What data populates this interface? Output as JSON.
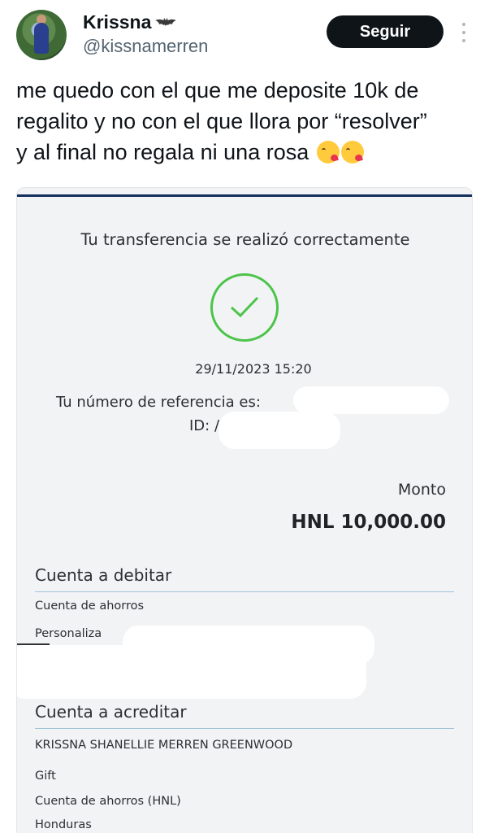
{
  "tweet": {
    "display_name": "Krissna",
    "name_icon": "bat-icon",
    "handle": "@kissnamerren",
    "follow_label": "Seguir",
    "text_lines": [
      "me quedo con el que me deposite 10k de",
      "regalito y no con el que llora por “resolver”",
      "y al final no regala ni una rosa"
    ],
    "emojis": [
      "kissing-face-icon",
      "kissing-face-icon"
    ]
  },
  "receipt": {
    "title": "Tu transferencia se realizó correctamente",
    "datetime": "29/11/2023 15:20",
    "reference_label": "Tu número de referencia es:",
    "id_label": "ID: /",
    "amount_label": "Monto",
    "amount_value": "HNL 10,000.00",
    "debit": {
      "title": "Cuenta a debitar",
      "account_type": "Cuenta de ahorros",
      "custom_label": "Personaliza"
    },
    "credit": {
      "title": "Cuenta a acreditar",
      "holder": "KRISSNA SHANELLIE MERREN GREENWOOD",
      "alias": "Gift",
      "account_type": "Cuenta de ahorros (HNL)",
      "country": "Honduras"
    },
    "colors": {
      "success": "#4cc44a",
      "header_bar": "#13305c",
      "divider": "#9fc3d8"
    }
  }
}
